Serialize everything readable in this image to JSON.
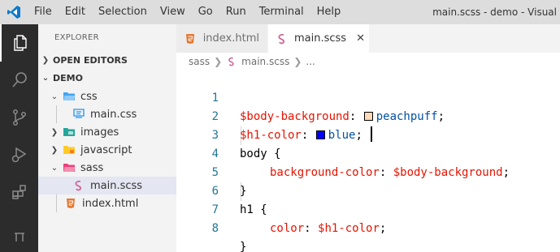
{
  "window": {
    "title": "main.scss - demo - Visual",
    "menu": [
      "File",
      "Edit",
      "Selection",
      "View",
      "Go",
      "Run",
      "Terminal",
      "Help"
    ]
  },
  "activity_bar": {
    "icons": [
      "explorer-icon",
      "search-icon",
      "source-control-icon",
      "run-debug-icon",
      "extensions-icon",
      "accounts-icon"
    ]
  },
  "sidebar": {
    "title": "EXPLORER",
    "open_editors": "OPEN EDITORS",
    "workspace": "DEMO",
    "tree": {
      "css": "css",
      "main_css": "main.css",
      "images": "images",
      "javascript": "javascript",
      "sass": "sass",
      "main_scss": "main.scss",
      "index_html": "index.html"
    }
  },
  "tabs": {
    "tab1": "index.html",
    "tab2": "main.scss",
    "close": "✕"
  },
  "breadcrumb": {
    "folder": "sass",
    "file": "main.scss",
    "more": "..."
  },
  "code": {
    "l1": {
      "num": "1",
      "var": "$body-background",
      "colon": ": ",
      "value": "peachpuff",
      "end": ";"
    },
    "l2": {
      "num": "2",
      "var": "$h1-color",
      "colon": ": ",
      "value": "blue",
      "end": ";"
    },
    "l3": {
      "num": "3",
      "text": "body {"
    },
    "l4": {
      "num": "4",
      "prop": "background-color",
      "colon": ": ",
      "value": "$body-background",
      "end": ";"
    },
    "l5": {
      "num": "5",
      "text": "}"
    },
    "l6": {
      "num": "6",
      "text": "h1 {"
    },
    "l7": {
      "num": "7",
      "prop": "color",
      "colon": ": ",
      "value": "$h1-color",
      "end": ";"
    },
    "l8": {
      "num": "8",
      "text": "}"
    }
  },
  "colors": {
    "activity_bar": "#2c2c2c",
    "sass_pink": "#cd6799",
    "html_orange": "#e37933",
    "css_blue": "#42a5f5",
    "peachpuff": "#ffdab9",
    "blue": "#0000ff"
  }
}
